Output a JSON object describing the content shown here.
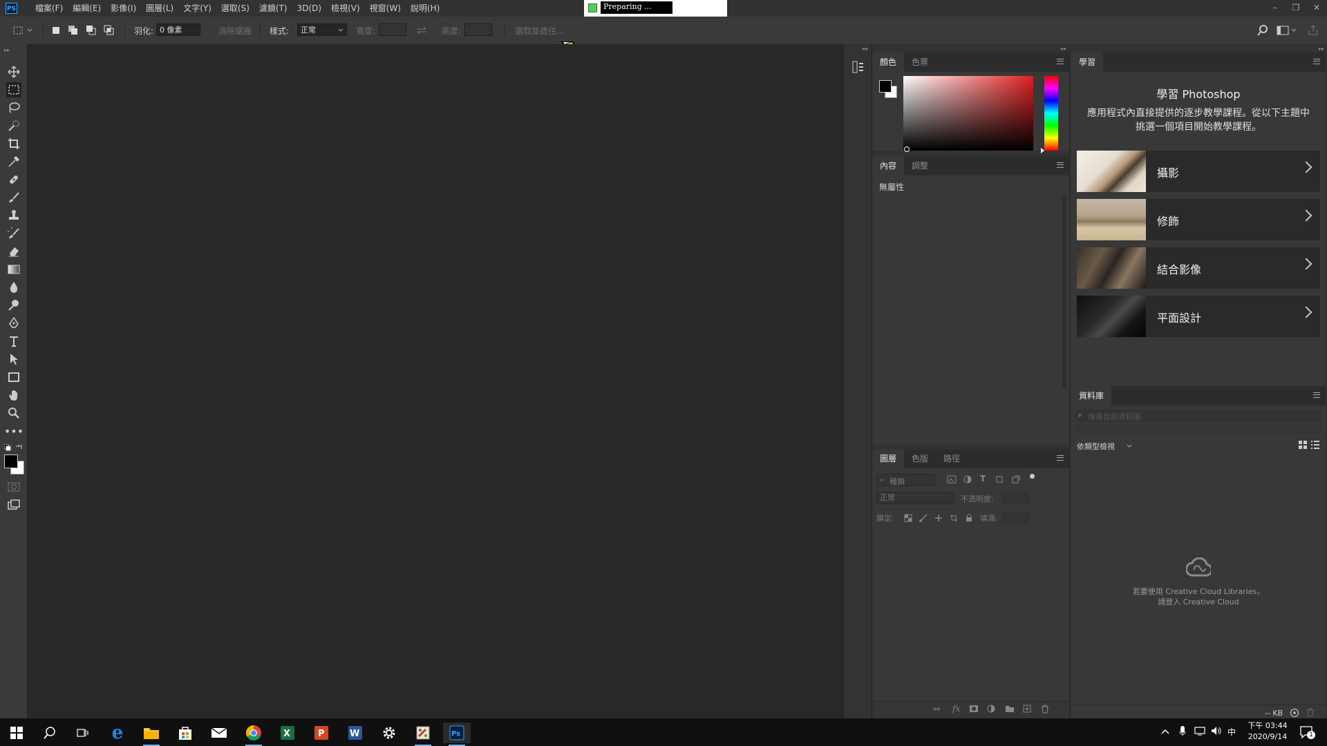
{
  "menubar": {
    "app_icon": "PS",
    "menus": [
      "檔案(F)",
      "編輯(E)",
      "影像(I)",
      "圖層(L)",
      "文字(Y)",
      "選取(S)",
      "濾鏡(T)",
      "3D(D)",
      "檢視(V)",
      "視窗(W)",
      "說明(H)"
    ],
    "preparing_text": "Preparing ...",
    "window_controls": [
      "minimize-icon",
      "restore-icon",
      "close-icon"
    ]
  },
  "options": {
    "feather_label": "羽化:",
    "feather_value": "0 像素",
    "antialias_label": "消除鋸齒",
    "style_label": "樣式:",
    "style_value": "正常",
    "width_label": "寬度:",
    "height_label": "高度:",
    "select_mask_label": "選取並遮住..."
  },
  "tools": [
    "move-tool-icon",
    "marquee-tool-icon",
    "lasso-tool-icon",
    "quick-select-tool-icon",
    "crop-tool-icon",
    "eyedropper-tool-icon",
    "healing-brush-icon",
    "brush-tool-icon",
    "clone-stamp-icon",
    "history-brush-icon",
    "eraser-tool-icon",
    "gradient-tool-icon",
    "blur-tool-icon",
    "dodge-tool-icon",
    "pen-tool-icon",
    "type-tool-icon",
    "path-select-icon",
    "rectangle-tool-icon",
    "hand-tool-icon",
    "zoom-tool-icon",
    "more-tools-icon"
  ],
  "color_panel": {
    "tabs": [
      "顏色",
      "色票"
    ],
    "hue_color": "#e02020"
  },
  "properties_panel": {
    "tabs": [
      "內容",
      "調整"
    ],
    "empty_text": "無屬性"
  },
  "layers_panel": {
    "tabs": [
      "圖層",
      "色版",
      "路徑"
    ],
    "filter_placeholder": "種類",
    "blend_mode": "正常",
    "opacity_label": "不透明度:",
    "lock_label": "鎖定:",
    "fill_label": "填滿:"
  },
  "learn_panel": {
    "tab": "學習",
    "heading": "學習 Photoshop",
    "description": "應用程式內直接提供的逐步教學課程。從以下主題中挑選一個項目開始教學課程。",
    "lessons": [
      {
        "title": "攝影"
      },
      {
        "title": "修飾"
      },
      {
        "title": "結合影像"
      },
      {
        "title": "平面設計"
      }
    ]
  },
  "libraries_panel": {
    "tab": "資料庫",
    "search_placeholder": "搜尋目前資料庫",
    "view_by": "依類型檢視",
    "signin_line1": "若要使用 Creative Cloud Libraries，",
    "signin_line2": "請登入 Creative Cloud",
    "storage": "-- KB"
  },
  "taskbar": {
    "apps": [
      "start-icon",
      "search-icon",
      "task-view-icon",
      "edge-icon",
      "file-explorer-icon",
      "store-icon",
      "mail-icon",
      "chrome-icon",
      "excel-icon",
      "powerpoint-icon",
      "word-icon",
      "settings-icon",
      "paint-icon",
      "photoshop-icon"
    ],
    "ime": "中",
    "time": "下午 03:44",
    "date": "2020/9/14",
    "notifications": "1"
  },
  "colors": {
    "accent": "#31a8ff",
    "panel_bg": "#383838",
    "canvas_bg": "#282828"
  }
}
